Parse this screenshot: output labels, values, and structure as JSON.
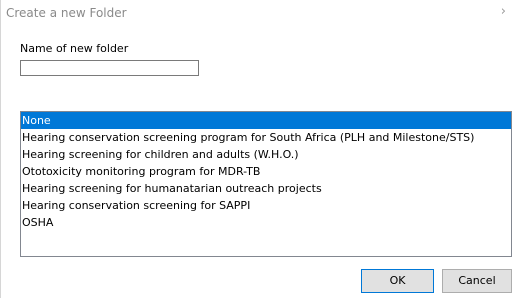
{
  "dialog": {
    "title": "Create a new Folder",
    "close_glyph": "›"
  },
  "form": {
    "name_label": "Name of new folder",
    "name_value": "",
    "name_placeholder": ""
  },
  "list": {
    "selected_index": 0,
    "items": [
      "None",
      "Hearing conservation screening program for South Africa (PLH and Milestone/STS)",
      "Hearing screening for children and adults (W.H.O.)",
      "Ototoxicity monitoring program for MDR-TB",
      "Hearing screening for humanatarian outreach projects",
      "Hearing conservation screening for SAPPI",
      "OSHA"
    ]
  },
  "buttons": {
    "ok_label": "OK",
    "cancel_label": "Cancel"
  },
  "colors": {
    "selection": "#0078d7"
  }
}
